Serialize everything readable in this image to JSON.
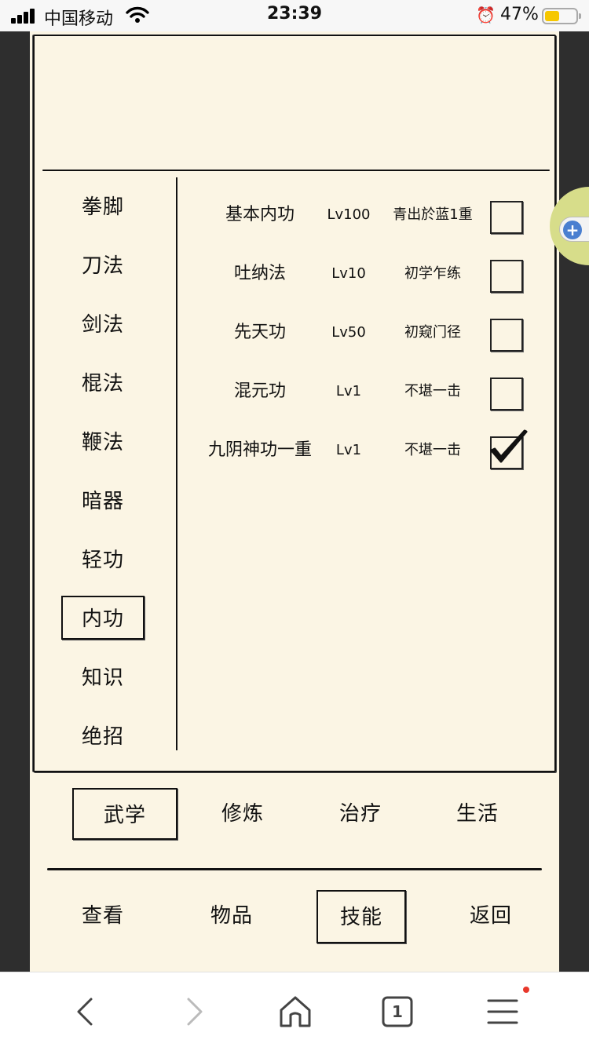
{
  "status_bar": {
    "carrier": "中国移动",
    "time": "23:39",
    "battery_pct": "47%",
    "colors": {
      "battery_fill": "#f6c700"
    }
  },
  "categories": [
    {
      "label": "拳脚",
      "active": false
    },
    {
      "label": "刀法",
      "active": false
    },
    {
      "label": "剑法",
      "active": false
    },
    {
      "label": "棍法",
      "active": false
    },
    {
      "label": "鞭法",
      "active": false
    },
    {
      "label": "暗器",
      "active": false
    },
    {
      "label": "轻功",
      "active": false
    },
    {
      "label": "内功",
      "active": true
    },
    {
      "label": "知识",
      "active": false
    },
    {
      "label": "绝招",
      "active": false
    }
  ],
  "skills": [
    {
      "name": "基本内功",
      "level": "Lv100",
      "rank": "青出於蓝1重",
      "checked": false
    },
    {
      "name": "吐纳法",
      "level": "Lv10",
      "rank": "初学乍练",
      "checked": false
    },
    {
      "name": "先天功",
      "level": "Lv50",
      "rank": "初窥门径",
      "checked": false
    },
    {
      "name": "混元功",
      "level": "Lv1",
      "rank": "不堪一击",
      "checked": false
    },
    {
      "name": "九阴神功一重",
      "level": "Lv1",
      "rank": "不堪一击",
      "checked": true
    }
  ],
  "tabs": [
    {
      "label": "武学",
      "active": true
    },
    {
      "label": "修炼",
      "active": false
    },
    {
      "label": "治疗",
      "active": false
    },
    {
      "label": "生活",
      "active": false
    }
  ],
  "nav": [
    {
      "label": "查看",
      "active": false
    },
    {
      "label": "物品",
      "active": false
    },
    {
      "label": "技能",
      "active": true
    },
    {
      "label": "返回",
      "active": false
    }
  ],
  "browser": {
    "tab_count": "1",
    "icons": [
      "back-icon",
      "forward-icon",
      "home-icon",
      "tabs-icon",
      "menu-icon"
    ]
  },
  "colors": {
    "paper": "#fbf5e4",
    "frame": "#2e2e2e",
    "ink": "#111111",
    "widget": "#d7dd8a",
    "notification_dot": "#e8372b"
  }
}
